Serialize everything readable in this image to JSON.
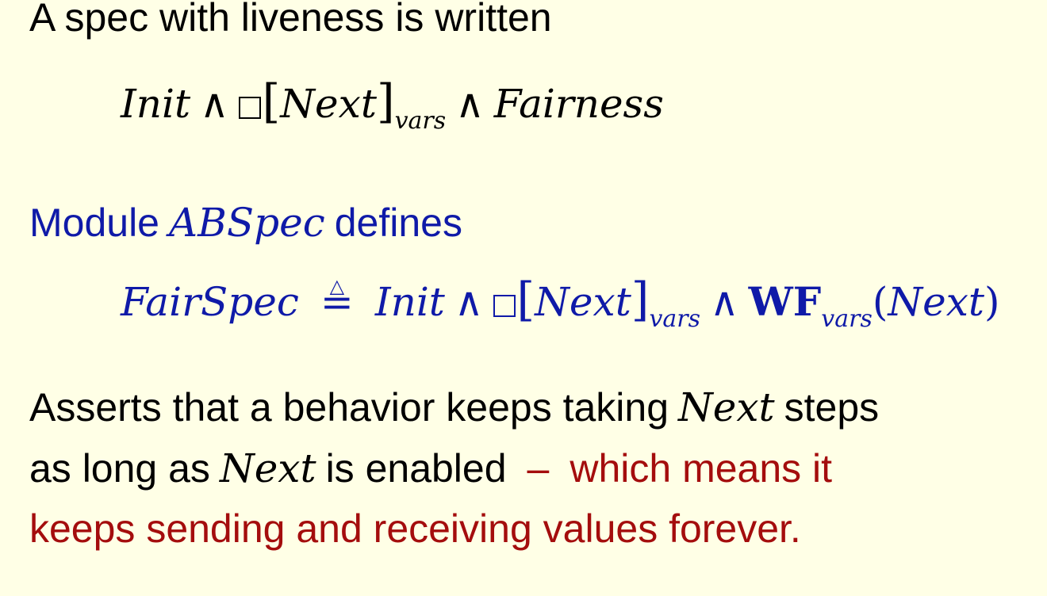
{
  "line1": {
    "text": "A spec with liveness is written"
  },
  "line2": {
    "init": "Init",
    "and": "∧",
    "lbr": "[",
    "next": "Next",
    "rbr": "]",
    "vars": "vars",
    "fairness": "Fairness"
  },
  "line3": {
    "module": "Module",
    "abspec": "ABSpec",
    "defines": "defines"
  },
  "line4": {
    "fairspec": "FairSpec",
    "defeq_bar": "=",
    "defeq_tri": "△",
    "init": "Init",
    "and": "∧",
    "lbr": "[",
    "next": "Next",
    "rbr": "]",
    "vars": "vars",
    "wf": "WF",
    "wf_vars": "vars",
    "lpar": "(",
    "wf_next": "Next",
    "rpar": ")"
  },
  "line5": {
    "before": "Asserts that a behavior keeps taking",
    "next": "Next",
    "after": "steps"
  },
  "line6": {
    "before": "as long as",
    "next": "Next",
    "after": "is enabled",
    "dash": "–",
    "red": "which means it"
  },
  "line7": {
    "text": "keeps sending and receiving values forever."
  },
  "colors": {
    "background": "#ffffe6",
    "black_text": "#000000",
    "blue_text": "#0f1aa8",
    "red_text": "#a40d0d"
  }
}
